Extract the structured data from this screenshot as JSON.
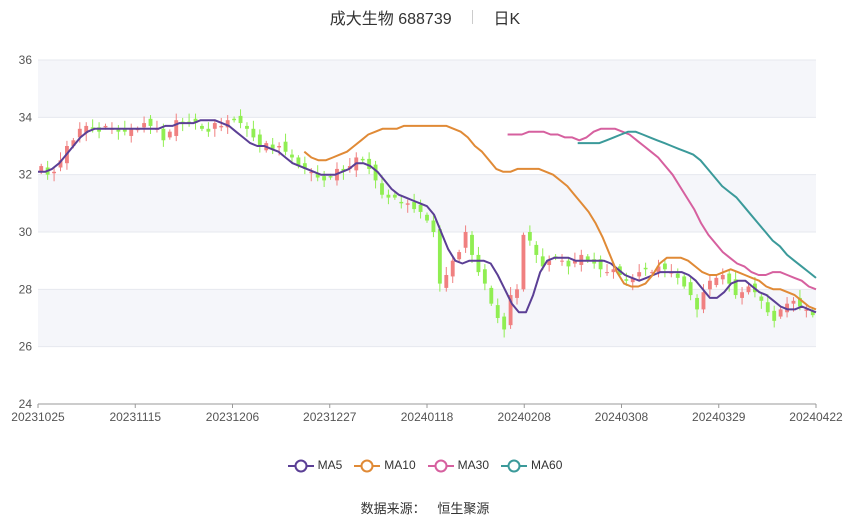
{
  "header": {
    "name_code": "成大生物 688739",
    "period": "日K"
  },
  "footer": {
    "source_label": "数据来源：",
    "source_name": "恒生聚源"
  },
  "chart_data": {
    "type": "candlestick",
    "ylim": [
      24,
      36
    ],
    "yticks": [
      24,
      26,
      28,
      30,
      32,
      34,
      36
    ],
    "xtick_labels": [
      "20231025",
      "20231115",
      "20231206",
      "20231227",
      "20240118",
      "20240208",
      "20240308",
      "20240329",
      "20240422"
    ],
    "up_color": "#f08080",
    "down_color": "#90ee52",
    "closes": [
      32.3,
      32.0,
      32.1,
      32.5,
      33.0,
      33.2,
      33.6,
      33.7,
      33.6,
      33.5,
      33.7,
      33.6,
      33.5,
      33.5,
      33.6,
      33.6,
      33.8,
      33.7,
      33.6,
      33.2,
      33.5,
      33.9,
      33.8,
      33.8,
      33.8,
      33.6,
      33.5,
      33.8,
      33.7,
      33.9,
      33.9,
      33.8,
      33.6,
      33.3,
      33.0,
      33.1,
      32.9,
      33.0,
      32.8,
      32.6,
      32.3,
      32.2,
      32.1,
      31.9,
      31.8,
      31.9,
      32.2,
      32.1,
      32.3,
      32.6,
      32.5,
      32.2,
      31.8,
      31.3,
      31.2,
      31.2,
      31.0,
      31.0,
      30.8,
      30.7,
      30.4,
      30.0,
      28.2,
      28.5,
      29.0,
      29.3,
      30.0,
      29.2,
      28.6,
      28.2,
      27.5,
      27.0,
      26.6,
      27.8,
      28.0,
      29.9,
      29.7,
      29.2,
      28.8,
      29.0,
      29.1,
      29.0,
      28.8,
      29.0,
      29.2,
      29.0,
      28.9,
      28.7,
      28.6,
      28.7,
      28.5,
      28.3,
      28.4,
      28.6,
      28.7,
      28.6,
      28.8,
      28.7,
      28.6,
      28.4,
      28.1,
      27.8,
      27.3,
      27.9,
      28.3,
      28.4,
      28.5,
      28.2,
      27.8,
      27.9,
      28.1,
      27.9,
      27.6,
      27.2,
      26.9,
      27.3,
      27.5,
      27.6,
      27.4,
      27.3,
      27.1
    ],
    "series": [
      {
        "name": "MA5",
        "color": "#5b3f95",
        "values": [
          32.1,
          32.1,
          32.2,
          32.4,
          32.7,
          33.0,
          33.3,
          33.5,
          33.6,
          33.6,
          33.6,
          33.6,
          33.6,
          33.6,
          33.6,
          33.6,
          33.6,
          33.6,
          33.7,
          33.7,
          33.8,
          33.8,
          33.8,
          33.9,
          33.9,
          33.9,
          33.8,
          33.7,
          33.5,
          33.3,
          33.1,
          33.0,
          33.0,
          32.9,
          32.8,
          32.6,
          32.4,
          32.3,
          32.2,
          32.1,
          32.0,
          32.0,
          32.0,
          32.1,
          32.2,
          32.4,
          32.4,
          32.3,
          32.1,
          31.8,
          31.5,
          31.3,
          31.2,
          31.1,
          31.0,
          30.9,
          30.6,
          30.0,
          29.4,
          29.0,
          28.9,
          29.0,
          29.0,
          29.0,
          28.9,
          28.5,
          28.0,
          27.5,
          27.2,
          27.2,
          27.8,
          28.6,
          29.0,
          29.1,
          29.1,
          29.1,
          29.0,
          29.0,
          29.0,
          29.0,
          29.0,
          28.9,
          28.7,
          28.5,
          28.4,
          28.3,
          28.4,
          28.5,
          28.6,
          28.6,
          28.6,
          28.6,
          28.5,
          28.3,
          28.0,
          27.7,
          27.7,
          27.9,
          28.2,
          28.3,
          28.3,
          28.1,
          27.9,
          27.8,
          27.6,
          27.4,
          27.3,
          27.3,
          27.4,
          27.3,
          27.2
        ]
      },
      {
        "name": "MA10",
        "color": "#e08a36",
        "values": [
          32.8,
          32.6,
          32.5,
          32.5,
          32.6,
          32.7,
          32.8,
          33.0,
          33.2,
          33.4,
          33.5,
          33.6,
          33.6,
          33.6,
          33.7,
          33.7,
          33.7,
          33.7,
          33.7,
          33.7,
          33.7,
          33.6,
          33.5,
          33.3,
          33.0,
          32.8,
          32.5,
          32.2,
          32.1,
          32.1,
          32.2,
          32.2,
          32.2,
          32.2,
          32.1,
          32.0,
          31.8,
          31.6,
          31.3,
          31.0,
          30.7,
          30.3,
          29.8,
          29.2,
          28.6,
          28.2,
          28.1,
          28.1,
          28.2,
          28.5,
          28.9,
          29.1,
          29.1,
          29.1,
          29.0,
          28.8,
          28.6,
          28.5,
          28.5,
          28.6,
          28.7,
          28.6,
          28.5,
          28.4,
          28.3,
          28.1,
          28.0,
          28.0,
          27.9,
          27.8,
          27.6,
          27.4,
          27.3
        ]
      },
      {
        "name": "MA30",
        "color": "#d6609f",
        "values": [
          33.4,
          33.4,
          33.4,
          33.5,
          33.5,
          33.5,
          33.4,
          33.4,
          33.3,
          33.3,
          33.2,
          33.3,
          33.5,
          33.6,
          33.6,
          33.6,
          33.5,
          33.4,
          33.2,
          33.0,
          32.8,
          32.6,
          32.3,
          32.0,
          31.6,
          31.2,
          30.8,
          30.3,
          29.9,
          29.6,
          29.3,
          29.1,
          28.9,
          28.8,
          28.6,
          28.5,
          28.5,
          28.6,
          28.6,
          28.5,
          28.4,
          28.3,
          28.1,
          28.0
        ]
      },
      {
        "name": "MA60",
        "color": "#3b9a9a",
        "values": [
          33.1,
          33.1,
          33.1,
          33.1,
          33.2,
          33.3,
          33.4,
          33.5,
          33.5,
          33.4,
          33.3,
          33.2,
          33.1,
          33.0,
          32.9,
          32.8,
          32.7,
          32.5,
          32.2,
          31.9,
          31.6,
          31.4,
          31.2,
          30.9,
          30.6,
          30.3,
          30.0,
          29.7,
          29.5,
          29.2,
          29.0,
          28.8,
          28.6,
          28.4
        ]
      }
    ]
  }
}
